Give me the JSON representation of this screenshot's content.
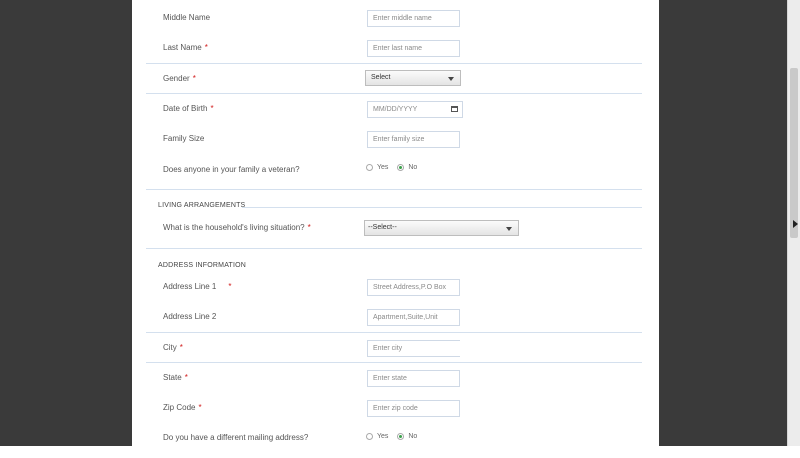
{
  "form": {
    "middle_name": {
      "label": "Middle Name",
      "placeholder": "Enter middle name",
      "required": false
    },
    "last_name": {
      "label": "Last Name",
      "placeholder": "Enter last name",
      "required": true
    },
    "gender": {
      "label": "Gender",
      "selected": "Select",
      "required": true
    },
    "dob": {
      "label": "Date of Birth",
      "placeholder": "MM/DD/YYYY",
      "required": true
    },
    "family_size": {
      "label": "Family Size",
      "placeholder": "Enter family size",
      "required": false
    },
    "veteran": {
      "label": "Does anyone in your family a veteran?",
      "options": [
        "Yes",
        "No"
      ],
      "selected": "No"
    }
  },
  "living": {
    "heading": "LIVING ARRANGEMENTS",
    "situation": {
      "label": "What is the household's living situation?",
      "selected": "--Select--",
      "required": true
    }
  },
  "address": {
    "heading": "ADDRESS INFORMATION",
    "line1": {
      "label": "Address Line 1",
      "placeholder": "Street Address,P.O Box",
      "required": true
    },
    "line2": {
      "label": "Address Line 2",
      "placeholder": "Apartment,Suite,Unit",
      "required": false
    },
    "city": {
      "label": "City",
      "placeholder": "Enter city",
      "required": true
    },
    "state": {
      "label": "State",
      "placeholder": "Enter state",
      "required": true
    },
    "zip": {
      "label": "Zip Code",
      "placeholder": "Enter zip code",
      "required": true
    },
    "mailing": {
      "label": "Do you have a different mailing address?",
      "options": [
        "Yes",
        "No"
      ],
      "selected": "No"
    }
  },
  "required_marker": "*"
}
